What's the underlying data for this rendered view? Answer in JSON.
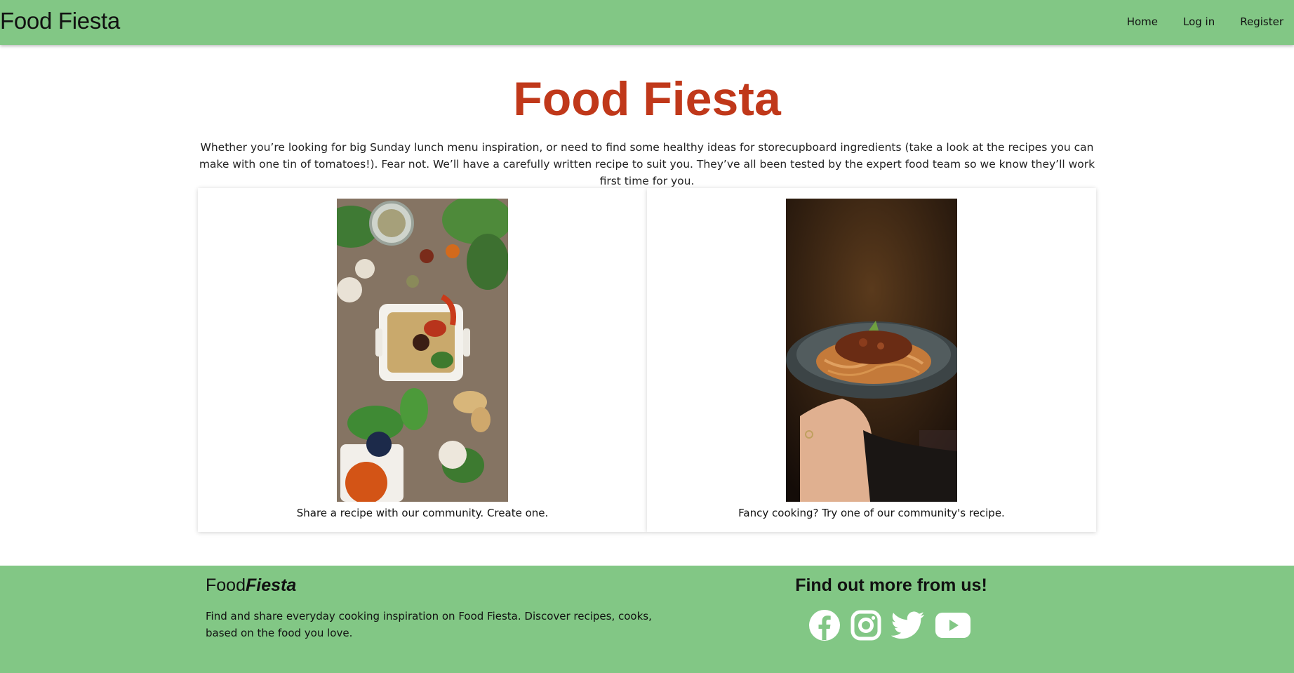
{
  "navbar": {
    "brand": "Food Fiesta",
    "links": [
      "Home",
      "Log in",
      "Register"
    ]
  },
  "hero": {
    "title": "Food Fiesta",
    "intro": "Whether you’re looking for big Sunday lunch menu inspiration, or need to find some healthy ideas for storecupboard ingredients (take a look at the recipes you can make with one tin of tomatoes!). Fear not. We’ll have a carefully written recipe to suit you. They’ve all been tested by the expert food team so we know they’ll work first time for you."
  },
  "cards": [
    {
      "caption": "Share a recipe with our community. Create one."
    },
    {
      "caption": "Fancy cooking? Try one of our community's recipe."
    }
  ],
  "footer": {
    "brand_part1": "Food",
    "brand_part2": "Fiesta",
    "description": "Find and share everyday cooking inspiration on Food Fiesta. Discover recipes, cooks, based on the food you love.",
    "social_heading": "Find out more from us!",
    "social_icons": [
      "facebook-icon",
      "instagram-icon",
      "twitter-icon",
      "youtube-icon"
    ]
  },
  "colors": {
    "navbar_bg": "#82c785",
    "title_color": "#c0381a",
    "footer_bg": "#82c785"
  }
}
